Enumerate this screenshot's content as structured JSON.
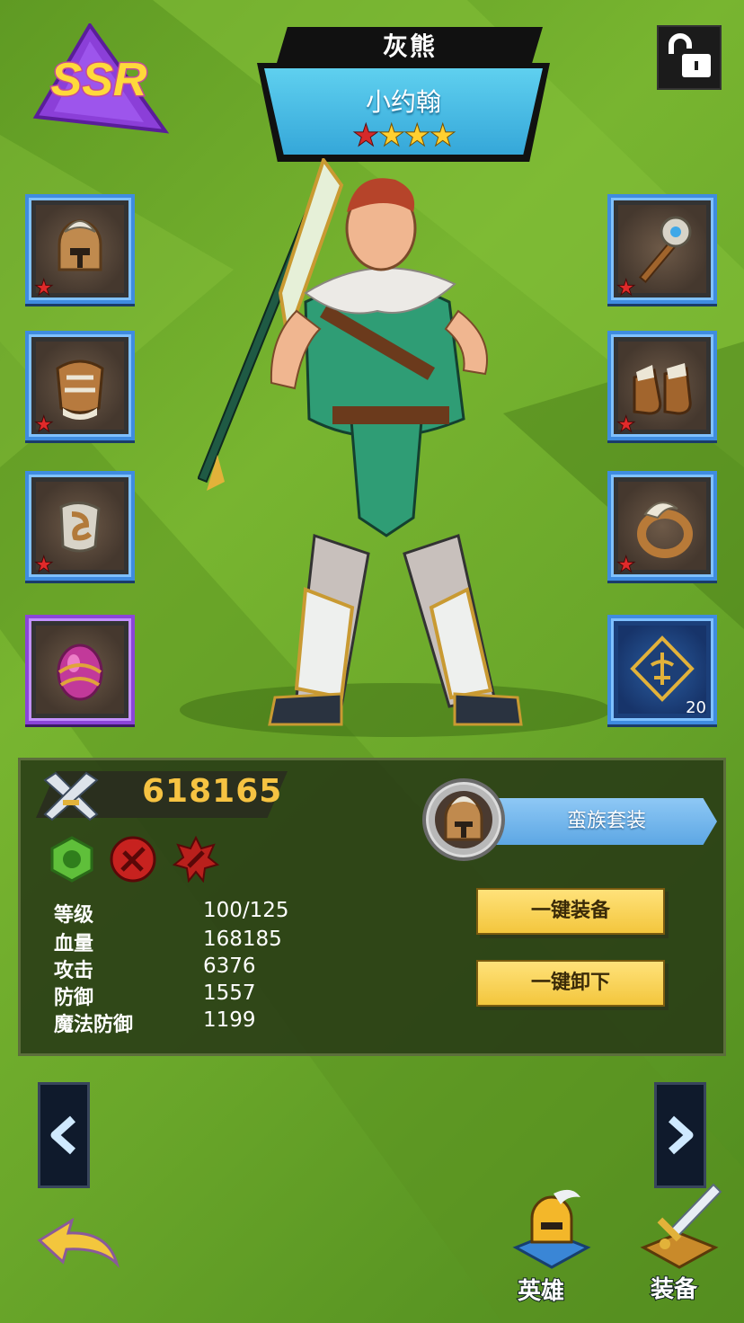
{
  "header": {
    "class_name": "灰熊",
    "hero_name": "小约翰",
    "rarity": "SSR",
    "stars": {
      "red": 1,
      "gold": 3
    }
  },
  "equipment": {
    "left": [
      {
        "name": "helmet-icon",
        "star": "★"
      },
      {
        "name": "armor-icon",
        "star": "★"
      },
      {
        "name": "belt-icon",
        "star": "★"
      },
      {
        "name": "gem-egg-icon",
        "star": ""
      }
    ],
    "right": [
      {
        "name": "mace-icon",
        "star": "★"
      },
      {
        "name": "boots-icon",
        "star": "★"
      },
      {
        "name": "ring-icon",
        "star": "★"
      },
      {
        "name": "emblem-icon",
        "count": "20"
      }
    ]
  },
  "stats": {
    "power": "618165",
    "rows": [
      {
        "label": "等级",
        "value": "100/125"
      },
      {
        "label": "血量",
        "value": "168185"
      },
      {
        "label": "攻击",
        "value": "6376"
      },
      {
        "label": "防御",
        "value": "1557"
      },
      {
        "label": "魔法防御",
        "value": "1199"
      }
    ]
  },
  "set": {
    "label": "蛮族套装"
  },
  "buttons": {
    "equip_all": "一键装备",
    "unequip_all": "一键卸下"
  },
  "bottom_nav": {
    "hero": "英雄",
    "equipment": "装备"
  },
  "colors": {
    "power": "#f6c342",
    "set_bar": "#6fb2ea",
    "button": "#f3c63d",
    "background": "#6aa72a"
  }
}
